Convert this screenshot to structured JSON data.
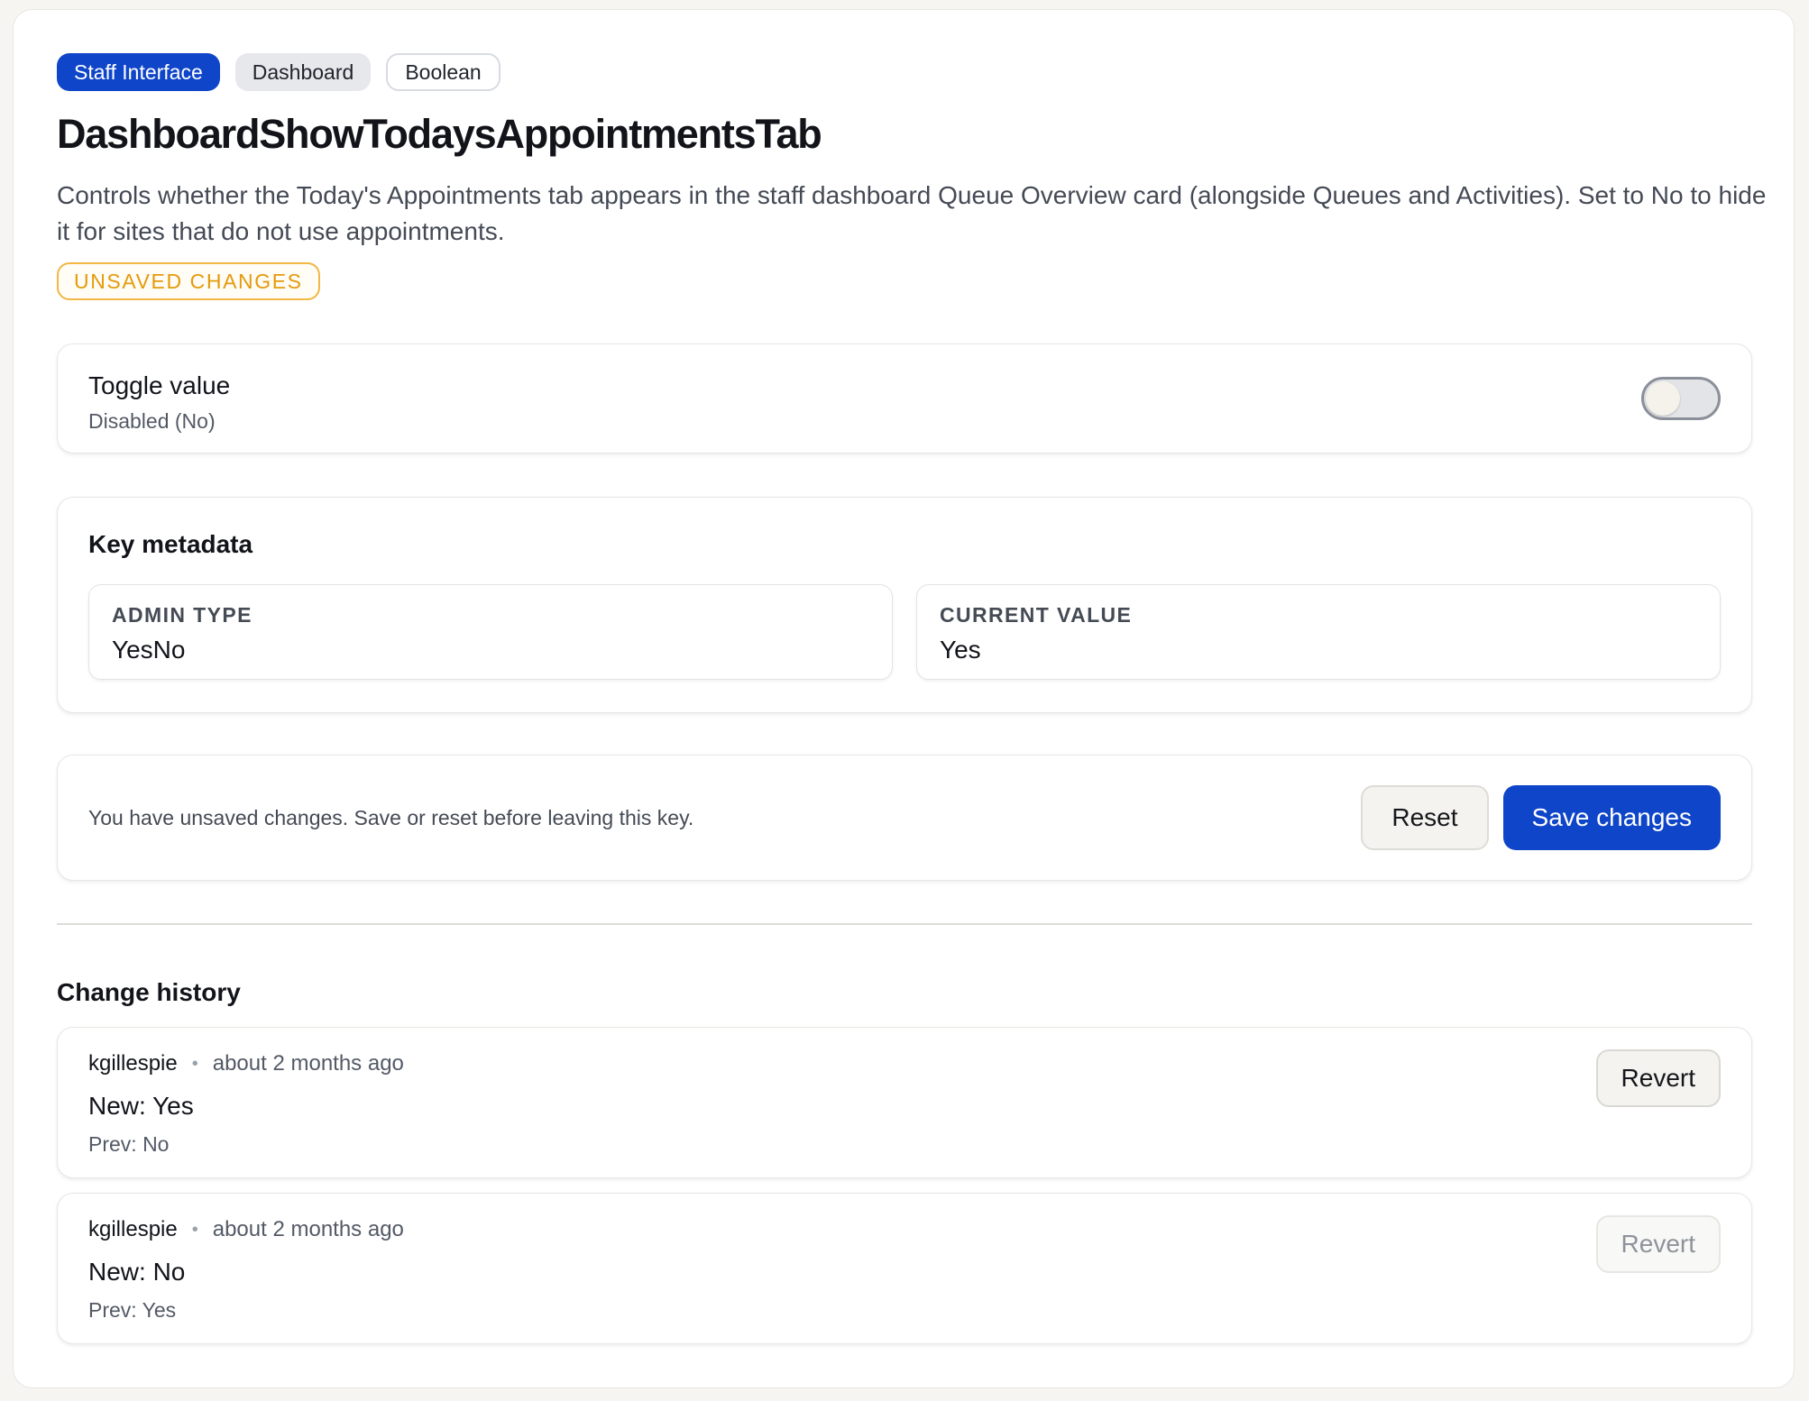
{
  "tags": [
    {
      "label": "Staff Interface"
    },
    {
      "label": "Dashboard"
    },
    {
      "label": "Boolean"
    }
  ],
  "title": "DashboardShowTodaysAppointmentsTab",
  "description": "Controls whether the Today's Appointments tab appears in the staff dashboard Queue Overview card (alongside Queues and Activities). Set to No to hide it for sites that do not use appointments.",
  "status_badge": "UNSAVED CHANGES",
  "toggle": {
    "title": "Toggle value",
    "state_label": "Disabled (No)",
    "checked": false
  },
  "metadata": {
    "heading": "Key metadata",
    "fields": [
      {
        "label": "ADMIN TYPE",
        "value": "YesNo"
      },
      {
        "label": "CURRENT VALUE",
        "value": "Yes"
      }
    ]
  },
  "actions": {
    "message": "You have unsaved changes. Save or reset before leaving this key.",
    "reset_label": "Reset",
    "save_label": "Save changes"
  },
  "history": {
    "heading": "Change history",
    "entries": [
      {
        "user": "kgillespie",
        "time": "about 2 months ago",
        "new": "New: Yes",
        "prev": "Prev: No",
        "revert_label": "Revert",
        "revert_enabled": true
      },
      {
        "user": "kgillespie",
        "time": "about 2 months ago",
        "new": "New: No",
        "prev": "Prev: Yes",
        "revert_label": "Revert",
        "revert_enabled": false
      }
    ]
  },
  "colors": {
    "primary": "#0f45c9",
    "warning": "#e59a0b",
    "background": "#f6f5f1"
  }
}
